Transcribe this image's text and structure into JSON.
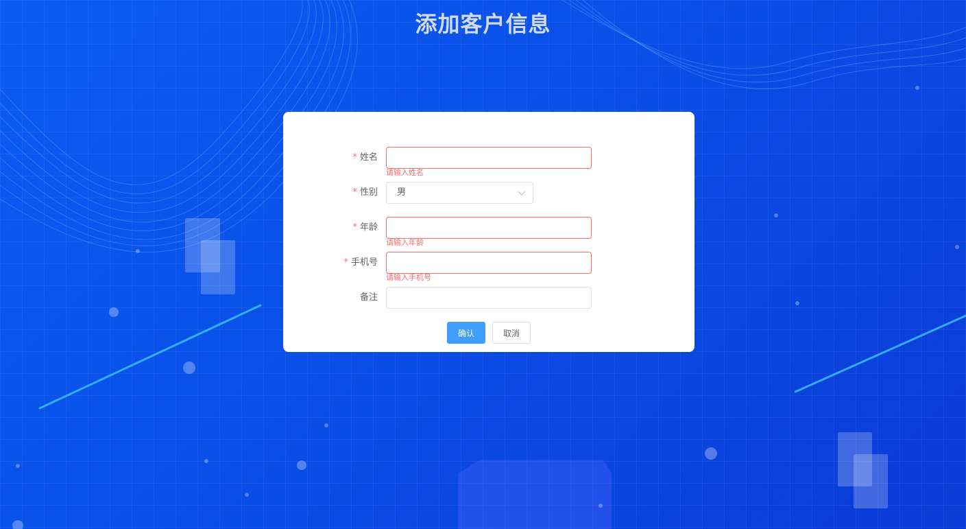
{
  "page": {
    "title": "添加客户信息"
  },
  "form": {
    "name": {
      "label": "姓名",
      "required_mark": "*",
      "value": "",
      "error": "请输入姓名"
    },
    "gender": {
      "label": "性别",
      "required_mark": "*",
      "value": "男"
    },
    "age": {
      "label": "年龄",
      "required_mark": "*",
      "value": "",
      "error": "请输入年龄"
    },
    "phone": {
      "label": "手机号",
      "required_mark": "*",
      "value": "",
      "error": "请输入手机号"
    },
    "remark": {
      "label": "备注",
      "value": ""
    }
  },
  "buttons": {
    "confirm": "确认",
    "cancel": "取消"
  },
  "colors": {
    "background": "#0a5cf2",
    "primary": "#409eff",
    "error": "#f56c6c",
    "title": "#d3dbe8"
  },
  "icons": {
    "select_arrow": "chevron-down-icon"
  }
}
